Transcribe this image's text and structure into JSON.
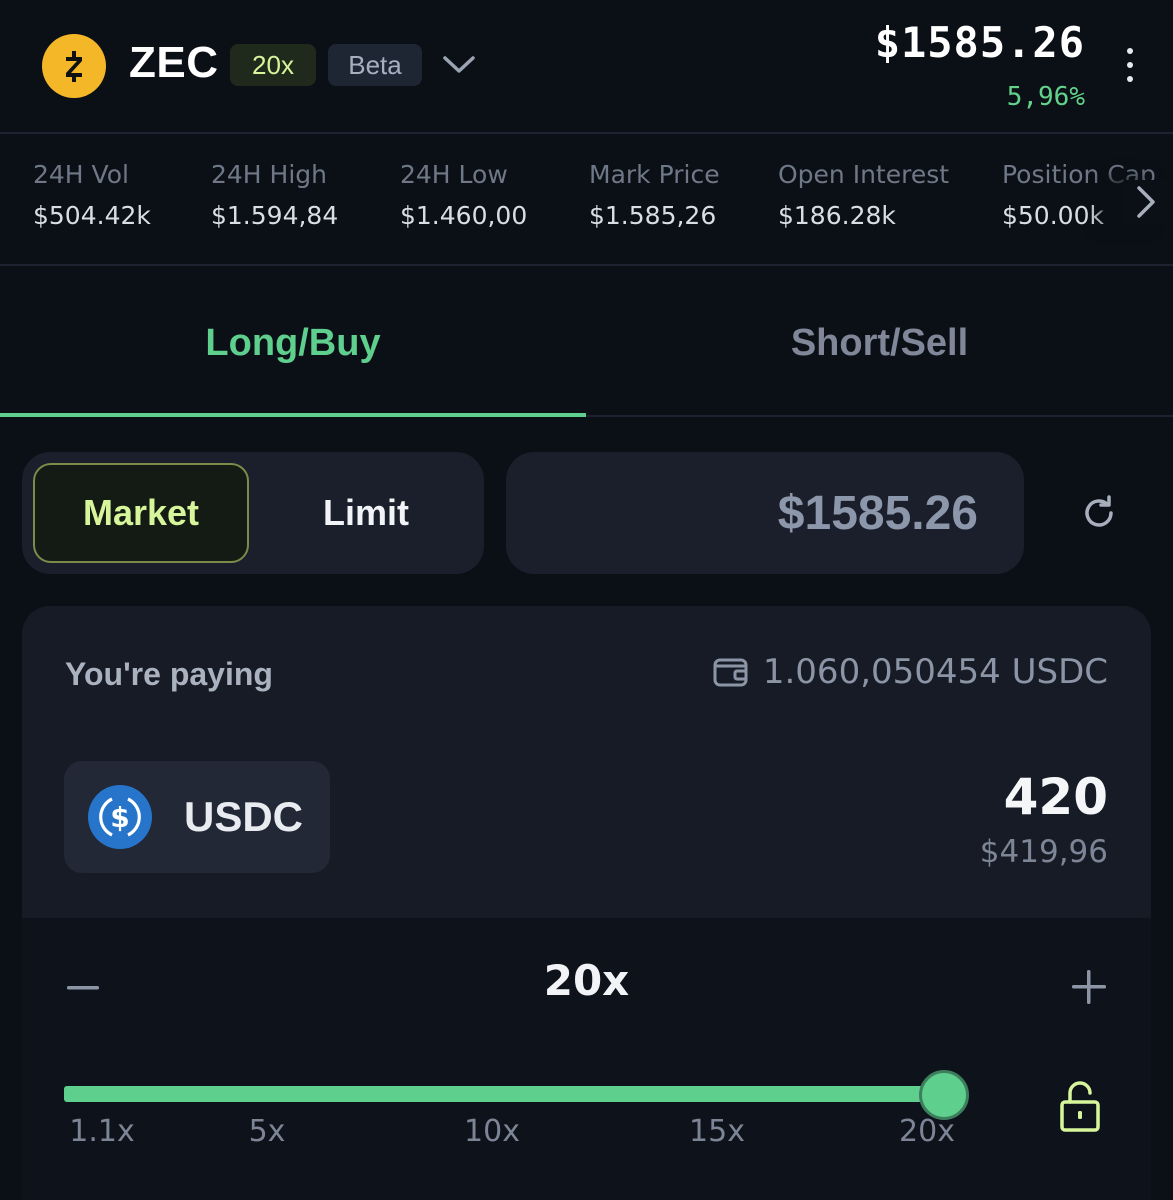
{
  "header": {
    "coin_icon": "zcash-logo-icon",
    "symbol": "ZEC",
    "leverage_badge": "20x",
    "beta_badge": "Beta",
    "price": "$1585.26",
    "change": "5,96%",
    "change_color": "#62d28a",
    "brand_color": "#f4b728"
  },
  "stats": [
    {
      "label": "24H Vol",
      "value": "$504.42k"
    },
    {
      "label": "24H High",
      "value": "$1.594,84"
    },
    {
      "label": "24H Low",
      "value": "$1.460,00"
    },
    {
      "label": "Mark Price",
      "value": "$1.585,26"
    },
    {
      "label": "Open Interest",
      "value": "$186.28k"
    },
    {
      "label": "Position Cap",
      "value": "$50.00k"
    }
  ],
  "tabs": {
    "long": "Long/Buy",
    "short": "Short/Sell",
    "active": "long",
    "accent_color": "#5fcf8e"
  },
  "order": {
    "market": "Market",
    "limit": "Limit",
    "selected": "market",
    "price": "$1585.26"
  },
  "paying": {
    "label": "You're paying",
    "balance": "1.060,050454 USDC",
    "token": "USDC",
    "amount": "420",
    "amount_usd": "$419,96"
  },
  "leverage": {
    "value": "20x",
    "slider_fraction": 1.0,
    "ticks": [
      "1.1x",
      "5x",
      "10x",
      "15x",
      "20x"
    ]
  }
}
